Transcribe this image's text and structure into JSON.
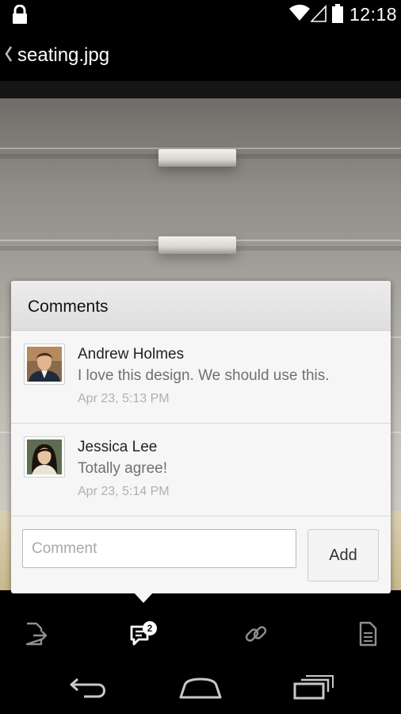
{
  "status_bar": {
    "time": "12:18",
    "icons": [
      "lock-icon",
      "wifi-icon",
      "signal-icon",
      "battery-icon"
    ]
  },
  "action_bar": {
    "title": "seating.jpg"
  },
  "comments_popup": {
    "title": "Comments",
    "comments": [
      {
        "author": "Andrew Holmes",
        "text": "I love this design. We should use this.",
        "time": "Apr 23, 5:13 PM"
      },
      {
        "author": "Jessica Lee",
        "text": "Totally agree!",
        "time": "Apr 23, 5:14 PM"
      }
    ],
    "input": {
      "placeholder": "Comment",
      "value": ""
    },
    "add_label": "Add"
  },
  "bottom_toolbar": {
    "items": [
      "share-icon",
      "comments-icon",
      "link-icon",
      "file-info-icon"
    ],
    "comments_badge": "2"
  },
  "nav_bar": {
    "items": [
      "back-icon",
      "home-icon",
      "recents-icon"
    ]
  },
  "colors": {
    "background": "#000000",
    "popup": "#f6f6f6",
    "popup_header": "#e3e3e3",
    "meta_text": "#b0b0b0"
  }
}
